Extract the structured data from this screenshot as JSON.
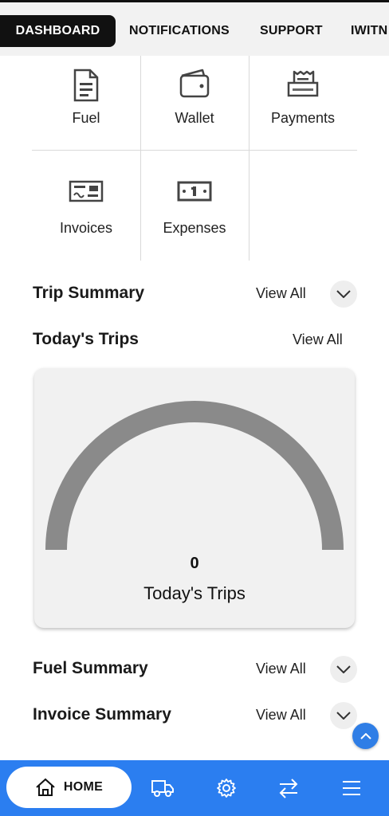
{
  "top_tabs": [
    {
      "label": "DASHBOARD",
      "active": true
    },
    {
      "label": "NOTIFICATIONS",
      "active": false
    },
    {
      "label": "SUPPORT",
      "active": false
    },
    {
      "label": "IWITN",
      "active": false
    }
  ],
  "quick_links": [
    {
      "label": "Fuel",
      "icon": "document-icon"
    },
    {
      "label": "Wallet",
      "icon": "wallet-icon"
    },
    {
      "label": "Payments",
      "icon": "receipt-icon"
    },
    {
      "label": "Invoices",
      "icon": "invoice-card-icon"
    },
    {
      "label": "Expenses",
      "icon": "cash-note-icon"
    }
  ],
  "trip_summary": {
    "title": "Trip Summary",
    "view_all": "View All"
  },
  "todays_trips": {
    "title": "Today's Trips",
    "view_all": "View All",
    "gauge_value": "0",
    "gauge_label": "Today's Trips"
  },
  "fuel_summary": {
    "title": "Fuel Summary",
    "view_all": "View All"
  },
  "invoice_summary": {
    "title": "Invoice Summary",
    "view_all": "View All"
  },
  "bottom_nav": {
    "home_label": "HOME",
    "items": [
      "home-icon",
      "truck-icon",
      "gear-icon",
      "swap-arrows-icon",
      "menu-icon"
    ]
  },
  "colors": {
    "accent": "#2b7ef0",
    "gauge": "#8a8a8a",
    "card_bg": "#f1f1f1",
    "active_tab_bg": "#111111"
  }
}
